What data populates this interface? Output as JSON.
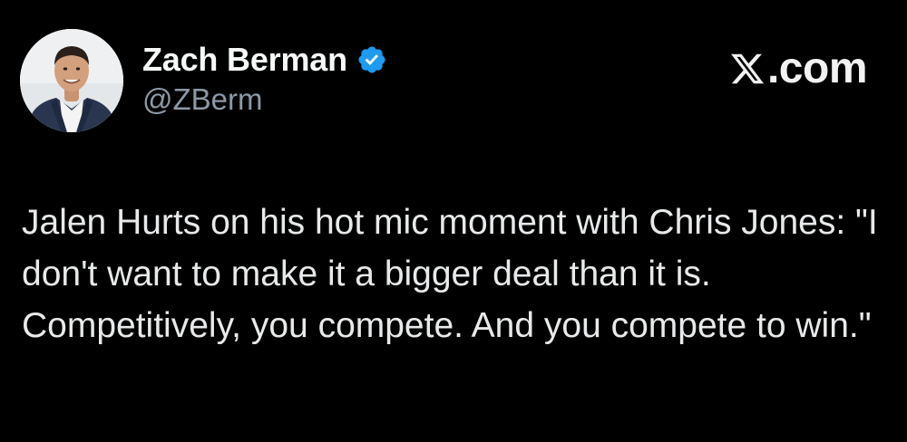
{
  "author": {
    "display_name": "Zach Berman",
    "handle": "@ZBerm",
    "verified": true,
    "avatar": "profile-photo"
  },
  "brand": {
    "icon": "x-logo-icon",
    "domain": ".com"
  },
  "tweet": {
    "text": "Jalen Hurts on his hot mic moment with Chris Jones: \"I don't want to make it a bigger deal than it is. Competitively, you compete. And you compete to win.\""
  },
  "colors": {
    "background": "#000000",
    "text_primary": "#e7e9ea",
    "text_secondary": "#8b98a5",
    "verified_badge": "#1d9bf0"
  }
}
